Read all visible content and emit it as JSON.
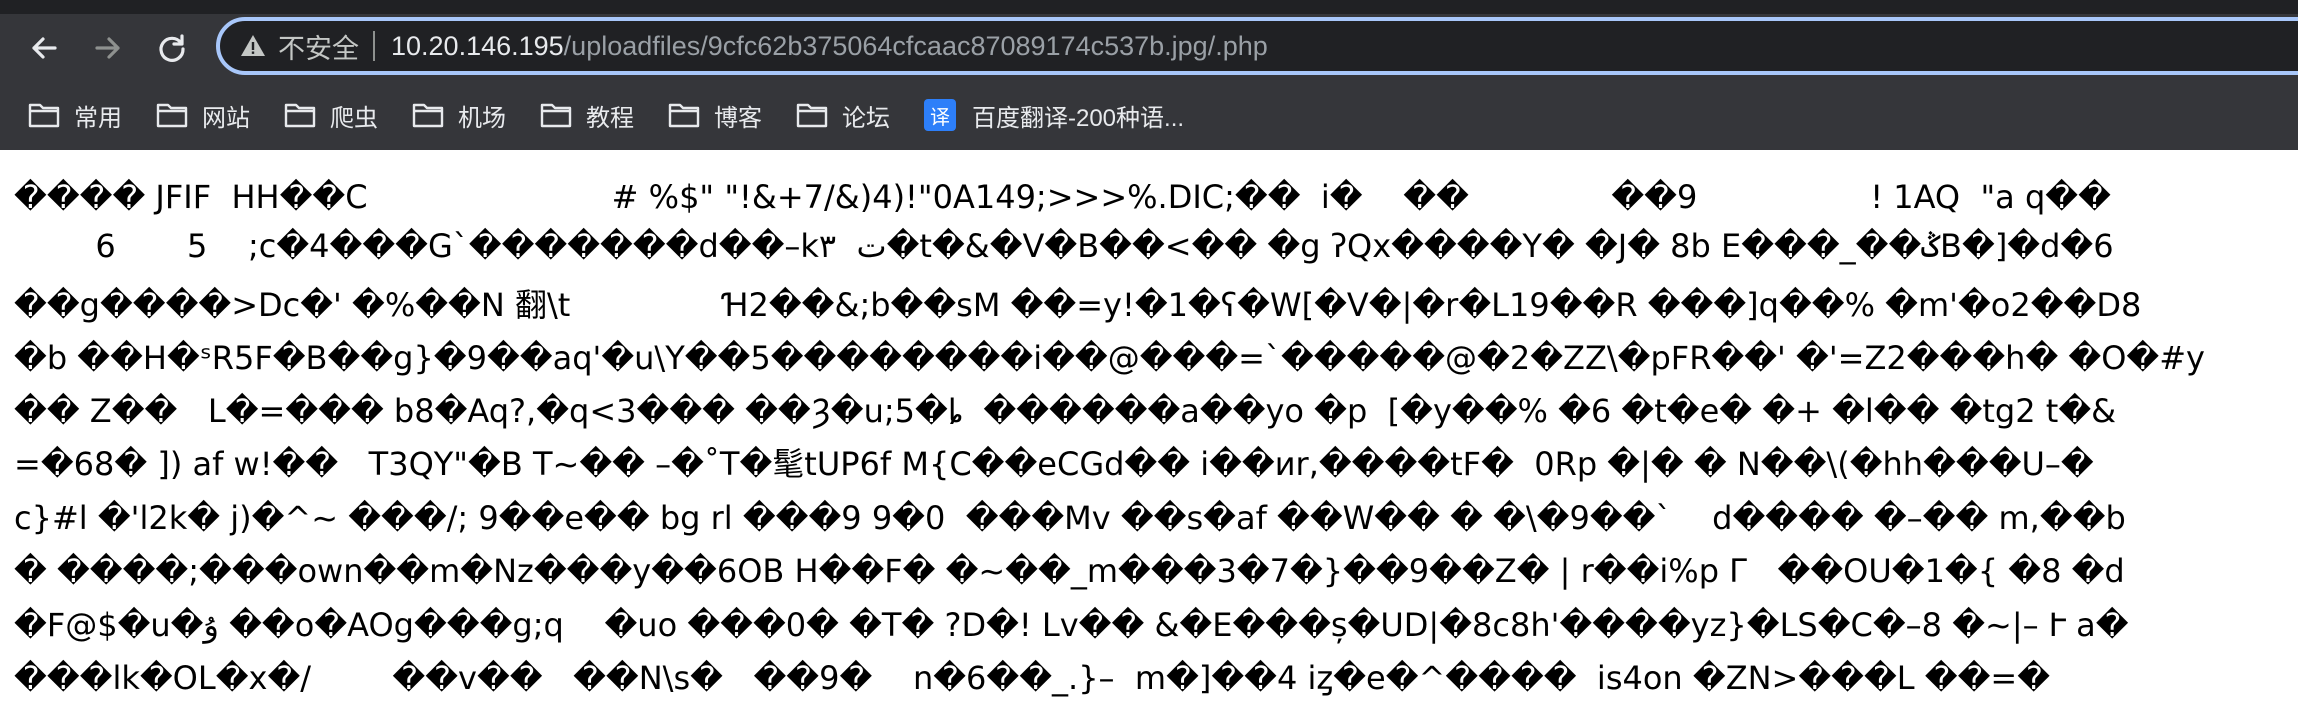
{
  "toolbar": {
    "back_icon": "arrow-left-icon",
    "forward_icon": "arrow-right-icon",
    "reload_icon": "reload-icon"
  },
  "address_bar": {
    "security_label": "不安全",
    "host": "10.20.146.195",
    "path": "/uploadfiles/9cfc62b375064cfcaac87089174c537b.jpg/.php"
  },
  "bookmarks": [
    {
      "label": "常用",
      "icon": "folder-icon"
    },
    {
      "label": "网站",
      "icon": "folder-icon"
    },
    {
      "label": "爬虫",
      "icon": "folder-icon"
    },
    {
      "label": "机场",
      "icon": "folder-icon"
    },
    {
      "label": "教程",
      "icon": "folder-icon"
    },
    {
      "label": "博客",
      "icon": "folder-icon"
    },
    {
      "label": "论坛",
      "icon": "folder-icon"
    },
    {
      "label": "百度翻译-200种语...",
      "icon": "translate-icon",
      "icon_glyph": "译"
    }
  ],
  "page_text": [
    "���� JFIF  HH��C                        # %$\" \"!&+7/&)4)!\"0A149;>>>%.DIC;��  i�    ��              ��9                 ! 1AQ  \"a q��",
    "        6       5    ;c�4���G`�������d��–kت  ٣�t�&�V�B��<�� �g ʔQx����Y� �J� 8b E���_��ݣB�]�d�6",
    "��g����>Dc�' �%��N 翻\\t               Ɦ2��&;b��sM ��=y!�1�ʕ�W[�V�|�r�L19��R ���]q��% �m'�o2��D8",
    "�b ��H�ˢR5F�B��g}�9��aq'�u\\Y��5��������i��@���=`�����@�2�ZZ\\�pFR��' �'=Z2���h� �O�#y  ",
    "�� Z��   L�=��� b8�Aq?,�q<3��� ��Ȝ�u;5�ȴ  ������a��yo �p  [�y��% �6 �t�e� �+ �l�� �tg2 t�&",
    "=�68� ]) af w!��   T3QY\"�B T~�� –�˚T�髦tUP6f M{C��eCGd�� i��иr,����tF�  0Rp �|� � N��\\(�hh���U–�",
    "c}#l �'l2k� j)�^~ ���/; 9��e�� bg rl ���9 9�0  ���Mv ��s�af ��W�� � �\\�9��`    d���� �–�� m,��b",
    "� ����;���own��m�Nz���y��6OB H��F� �~��_m���3�7�}��9��Z� | r��i%p Γ   ��OU�1�{ �8 �d",
    "�F@$�u�ۇ ��o�AOg���g;q    �uo ���0� �T� ?D�! Lv�� &�E���ș�UD|�8c8h'����yz}�LS�C�–8 �~|– Ւ a�",
    "���lk�OL�x�/        ��v��   ��N\\s�   ��9�    n�6��_.}–  m�]��4 iȥ�e�^����  is4on �ZN>���L ��=�"
  ]
}
